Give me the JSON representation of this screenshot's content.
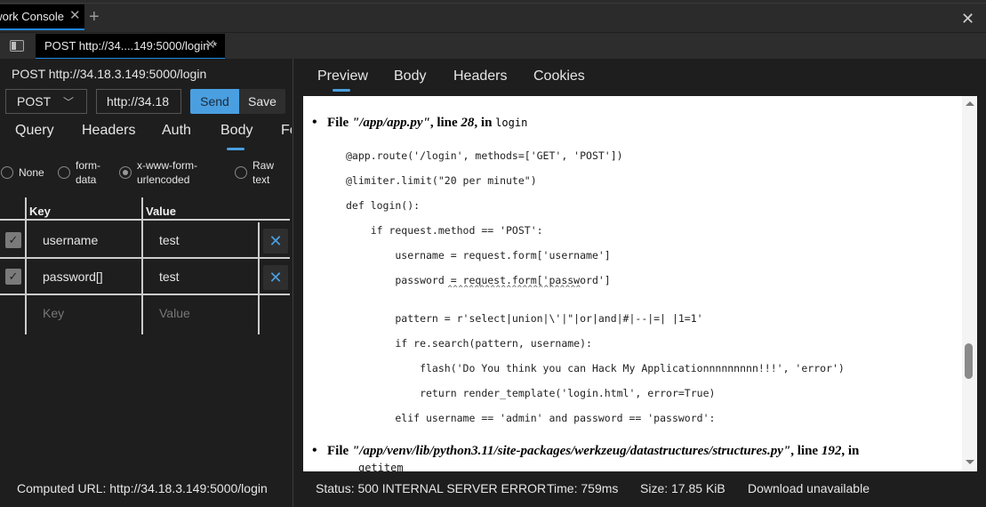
{
  "window": {
    "tab_label": "Network Console",
    "tab_visible_label": "work Console",
    "new_tab_icon": "plus-icon",
    "close_icon": "close-icon"
  },
  "request_tab": {
    "label": "POST http://34....149:5000/login *"
  },
  "request": {
    "title": "POST http://34.18.3.149:5000/login",
    "method": "POST",
    "url_value": "http://34.18.3.149:5000/login",
    "url_visible": "http://34.18",
    "send_label": "Send",
    "save_label": "Save",
    "tabs": [
      "Query",
      "Headers",
      "Auth",
      "Body",
      "Fo"
    ],
    "active_tab": "Body",
    "body_types": [
      {
        "label": "None",
        "selected": false
      },
      {
        "label": "form-\ndata",
        "selected": false
      },
      {
        "label": "x-www-form-\nurlencoded",
        "selected": true
      },
      {
        "label": "Raw\ntext",
        "selected": false
      }
    ],
    "kv_headers": {
      "key": "Key",
      "value": "Value"
    },
    "params": [
      {
        "checked": true,
        "key": "username",
        "value": "test"
      },
      {
        "checked": true,
        "key": "password[]",
        "value": "test"
      }
    ],
    "new_row": {
      "key_placeholder": "Key",
      "value_placeholder": "Value"
    },
    "computed_url": "Computed URL: http://34.18.3.149:5000/login"
  },
  "response": {
    "tabs": [
      "Preview",
      "Body",
      "Headers",
      "Cookies"
    ],
    "active_tab": "Preview",
    "frames": [
      {
        "prefix": "File ",
        "file": "\"/app/app.py\"",
        "mid": ", line ",
        "line": "28",
        "suffix": ", in ",
        "func": "login",
        "code": [
          "@app.route('/login', methods=['GET', 'POST'])",
          "@limiter.limit(\"20 per minute\")",
          "def login():",
          "    if request.method == 'POST':",
          "        username = request.form['username']",
          "        password = request.form['password']",
          "                   ^^^^^^^^^^^^^^^^^^^^^^^^^",
          "        pattern = r'select|union|\\'|\"|or|and|#|--|=| |1=1'",
          "        if re.search(pattern, username):",
          "            flash('Do You think you can Hack My Applicationnnnnnnnn!!!', 'error')",
          "            return render_template('login.html', error=True)",
          "        elif username == 'admin' and password == 'password':"
        ]
      },
      {
        "prefix": "File ",
        "file": "\"/app/venv/lib/python3.11/site-packages/werkzeug/datastructures/structures.py\"",
        "mid": ", line ",
        "line": "192",
        "suffix": ", in",
        "func": "getitem"
      }
    ],
    "status": "Status: 500 INTERNAL SERVER ERROR",
    "time": "Time: 759ms",
    "size": "Size: 17.85 KiB",
    "download": "Download unavailable"
  }
}
